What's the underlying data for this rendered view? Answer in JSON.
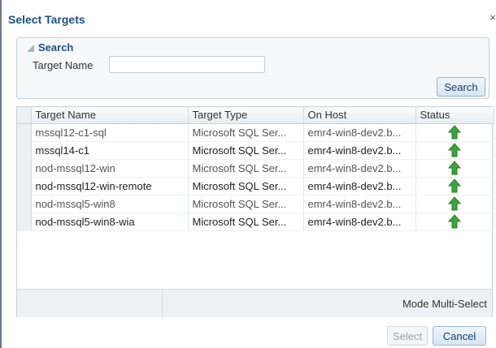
{
  "dialog": {
    "title": "Select Targets",
    "close_glyph": "×"
  },
  "search": {
    "section_title": "Search",
    "target_name_label": "Target Name",
    "target_name_value": "",
    "button_label": "Search"
  },
  "table": {
    "headers": [
      "Target Name",
      "Target Type",
      "On Host",
      "Status"
    ],
    "rows": [
      {
        "name": "mssql12-c1-sql",
        "type": "Microsoft SQL Ser...",
        "host": "emr4-win8-dev2.b...",
        "status": "up"
      },
      {
        "name": "mssql14-c1",
        "type": "Microsoft SQL Ser...",
        "host": "emr4-win8-dev2.b...",
        "status": "up"
      },
      {
        "name": "nod-mssql12-win",
        "type": "Microsoft SQL Ser...",
        "host": "emr4-win8-dev2.b...",
        "status": "up"
      },
      {
        "name": "nod-mssql12-win-remote",
        "type": "Microsoft SQL Ser...",
        "host": "emr4-win8-dev2.b...",
        "status": "up"
      },
      {
        "name": "nod-mssql5-win8",
        "type": "Microsoft SQL Ser...",
        "host": "emr4-win8-dev2.b...",
        "status": "up"
      },
      {
        "name": "nod-mssql5-win8-wia",
        "type": "Microsoft SQL Ser...",
        "host": "emr4-win8-dev2.b...",
        "status": "up"
      }
    ],
    "status_icon": "green-up-arrow-icon",
    "status_color": "#3aa53a"
  },
  "footer": {
    "mode_text": "Mode  Multi-Select"
  },
  "buttons": {
    "select_label": "Select",
    "cancel_label": "Cancel"
  }
}
